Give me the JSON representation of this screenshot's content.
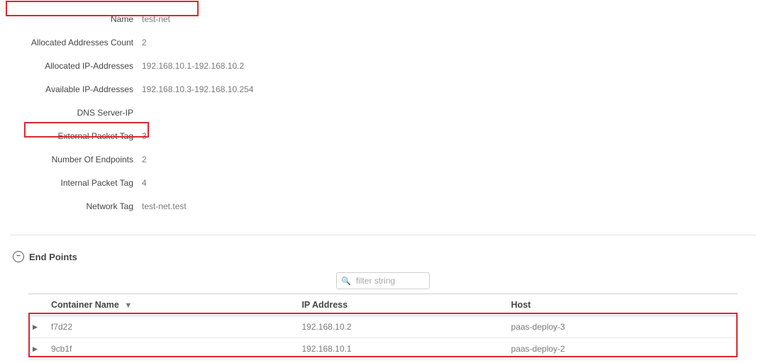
{
  "details": {
    "rows": [
      {
        "label": "Name",
        "value": "test-net"
      },
      {
        "label": "Allocated Addresses Count",
        "value": "2"
      },
      {
        "label": "Allocated IP-Addresses",
        "value": "192.168.10.1-192.168.10.2"
      },
      {
        "label": "Available IP-Addresses",
        "value": "192.168.10.3-192.168.10.254"
      },
      {
        "label": "DNS Server-IP",
        "value": ""
      },
      {
        "label": "External Packet Tag",
        "value": "3"
      },
      {
        "label": "Number Of Endpoints",
        "value": "2"
      },
      {
        "label": "Internal Packet Tag",
        "value": "4"
      },
      {
        "label": "Network Tag",
        "value": "test-net.test"
      }
    ]
  },
  "section": {
    "title": "End Points"
  },
  "filter": {
    "placeholder": "filter string"
  },
  "table": {
    "columns": {
      "c0": "Container Name",
      "c1": "IP Address",
      "c2": "Host"
    },
    "rows": [
      {
        "container": "f7d22",
        "ip": "192.168.10.2",
        "host": "paas-deploy-3"
      },
      {
        "container": "9cb1f",
        "ip": "192.168.10.1",
        "host": "paas-deploy-2"
      }
    ]
  }
}
